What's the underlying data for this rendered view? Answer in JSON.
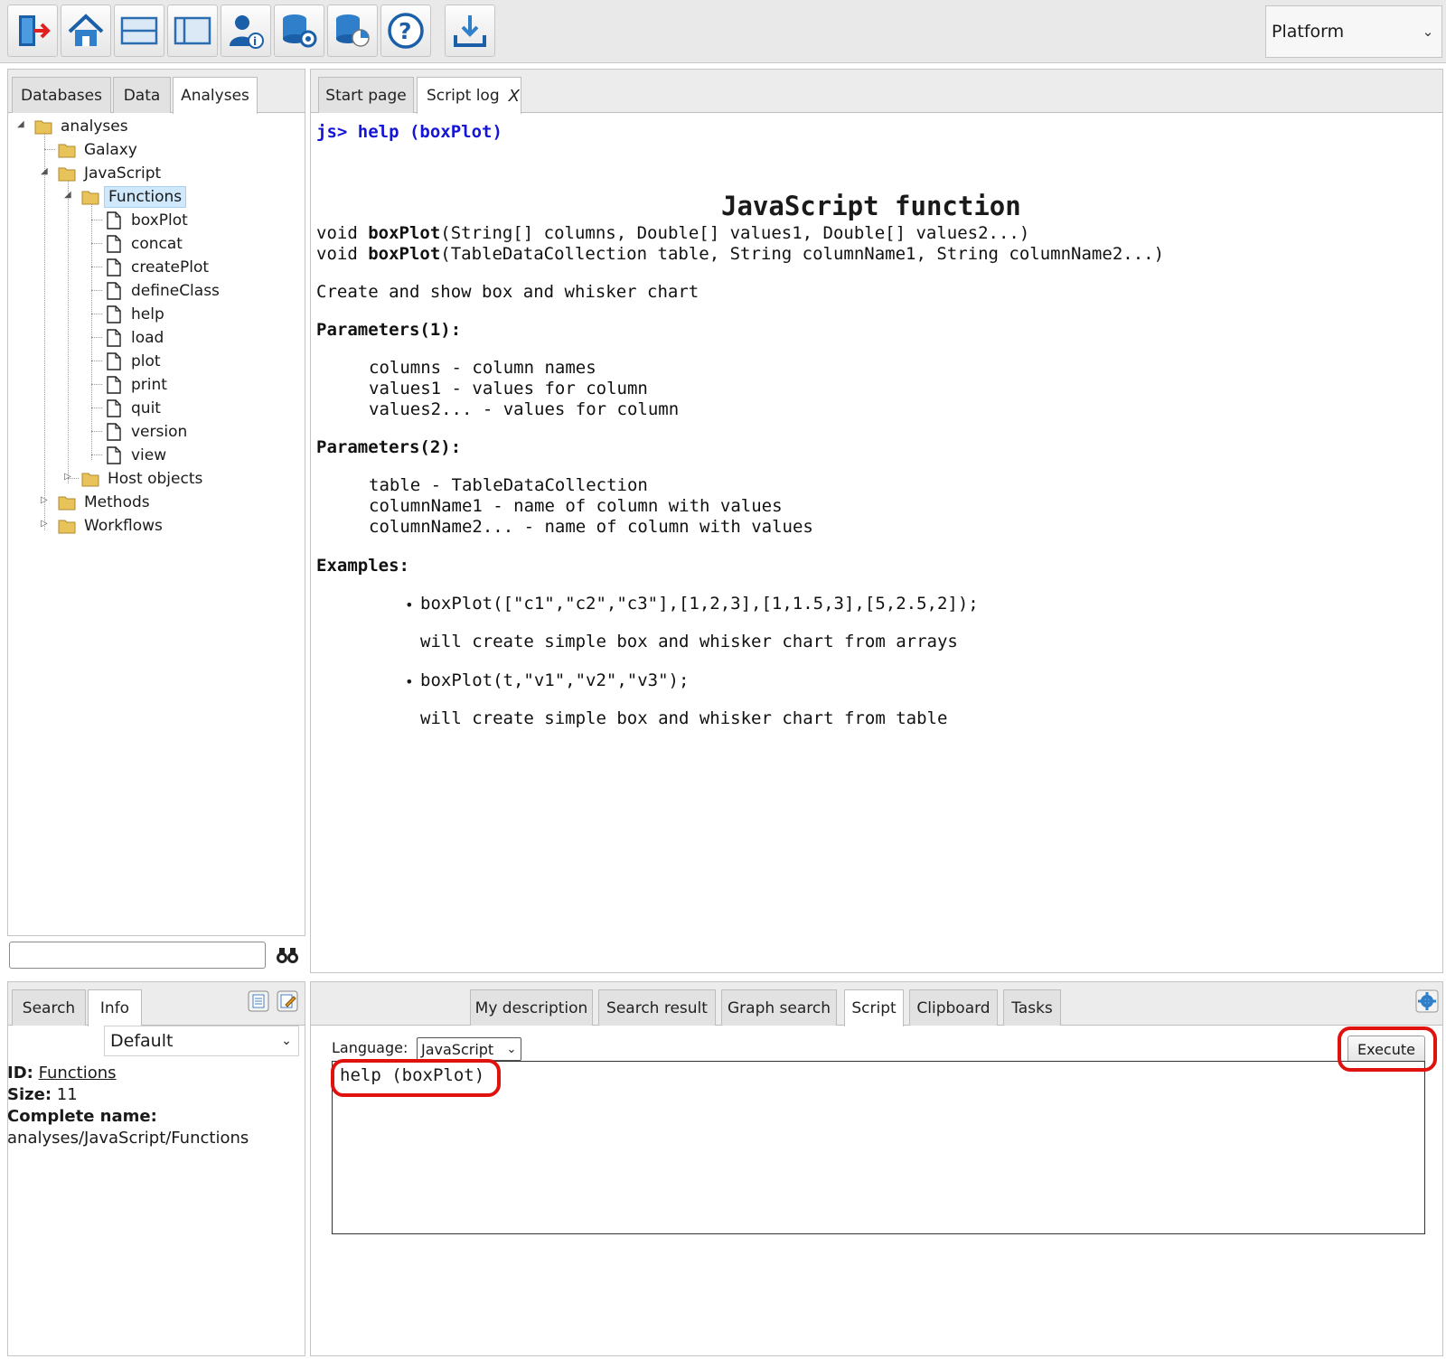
{
  "toolbar": {
    "buttons": [
      {
        "name": "exit-icon"
      },
      {
        "name": "home-icon"
      },
      {
        "name": "split-horizontal-icon"
      },
      {
        "name": "split-vertical-icon"
      },
      {
        "name": "user-info-icon"
      },
      {
        "name": "database-settings-icon"
      },
      {
        "name": "database-chart-icon"
      },
      {
        "name": "help-icon"
      },
      {
        "name": "download-icon"
      }
    ],
    "perspective": "Platform"
  },
  "left_top": {
    "tabs": [
      "Databases",
      "Data",
      "Analyses"
    ],
    "active_tab": "Analyses",
    "tree": {
      "root": "analyses",
      "galaxy": "Galaxy",
      "javascript": "JavaScript",
      "functions": "Functions",
      "function_items": [
        "boxPlot",
        "concat",
        "createPlot",
        "defineClass",
        "help",
        "load",
        "plot",
        "print",
        "quit",
        "version",
        "view"
      ],
      "host_objects": "Host objects",
      "methods": "Methods",
      "workflows": "Workflows"
    },
    "search_value": ""
  },
  "document": {
    "tabs": [
      "Start page",
      "Script log"
    ],
    "active_tab": "Script log",
    "close_glyph": "X",
    "prompt": "js> help (boxPlot)",
    "heading": "JavaScript function",
    "sig1_pre": "void ",
    "sig1_fn": "boxPlot",
    "sig1_args": "(String[] columns, Double[] values1, Double[] values2...)",
    "sig2_pre": "void ",
    "sig2_fn": "boxPlot",
    "sig2_args": "(TableDataCollection table, String columnName1, String columnName2...)",
    "description": "Create and show box and whisker chart",
    "params1_title": "Parameters(1):",
    "params1": [
      "columns - column names",
      "values1 - values for column",
      "values2... - values for column"
    ],
    "params2_title": "Parameters(2):",
    "params2": [
      "table - TableDataCollection",
      "columnName1 - name of column with values",
      "columnName2... - name of column with values"
    ],
    "examples_title": "Examples:",
    "examples": [
      {
        "code": "boxPlot([\"c1\",\"c2\",\"c3\"],[1,2,3],[1,1.5,3],[5,2.5,2]);",
        "note": "will create simple box and whisker chart from arrays"
      },
      {
        "code": "boxPlot(t,\"v1\",\"v2\",\"v3\");",
        "note": "will create simple box and whisker chart from table"
      }
    ]
  },
  "left_bottom": {
    "tabs": [
      "Search",
      "Info"
    ],
    "active_tab": "Info",
    "view_select": "Default",
    "id_label": "ID:",
    "id_value": "Functions",
    "size_label": "Size:",
    "size_value": "11",
    "complete_label": "Complete name:",
    "complete_value": "analyses/JavaScript/Functions"
  },
  "bottom": {
    "tabs": [
      "My description",
      "Search result",
      "Graph search",
      "Script",
      "Clipboard",
      "Tasks"
    ],
    "active_tab": "Script",
    "language_label": "Language:",
    "language_value": "JavaScript",
    "execute_label": "Execute",
    "script_text": "help (boxPlot)",
    "highlight_color": "#e0120e"
  }
}
